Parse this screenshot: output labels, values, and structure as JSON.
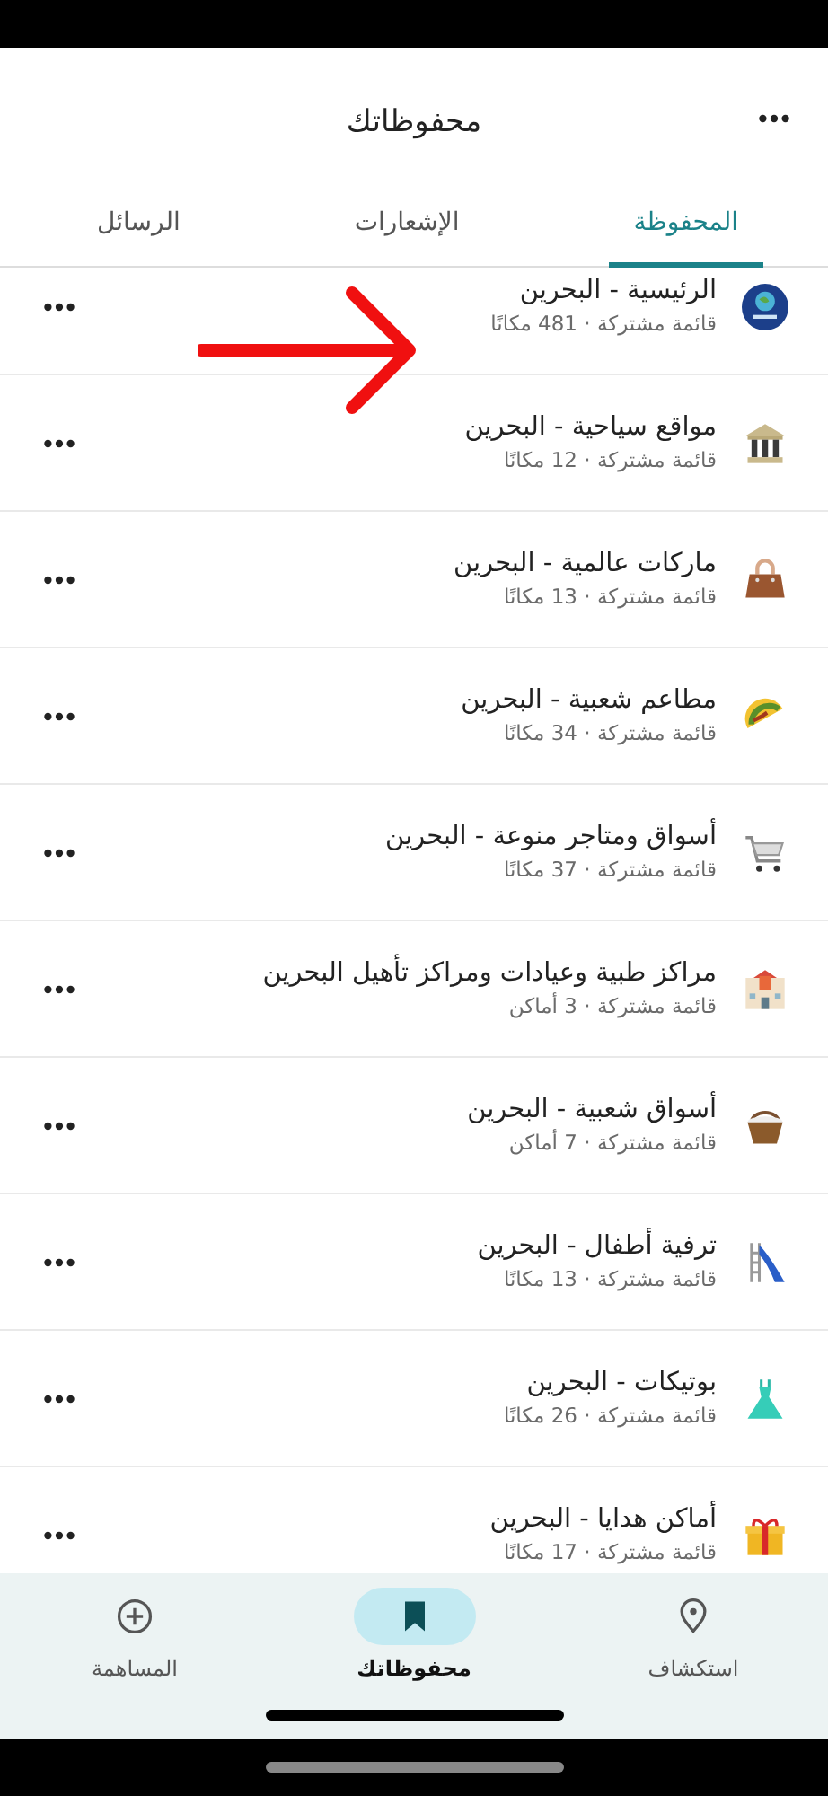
{
  "header": {
    "title": "محفوظاتك"
  },
  "tabs": [
    {
      "label": "المحفوظة",
      "selected": true
    },
    {
      "label": "الإشعارات",
      "selected": false
    },
    {
      "label": "الرسائل",
      "selected": false
    }
  ],
  "lists": [
    {
      "kind": "logo",
      "title": "الرئيسية - البحرين",
      "subtitle": "قائمة مشتركة · 481 مكانًا"
    },
    {
      "kind": "temple",
      "title": "مواقع سياحية - البحرين",
      "subtitle": "قائمة مشتركة · 12 مكانًا"
    },
    {
      "kind": "handbag",
      "title": "ماركات عالمية - البحرين",
      "subtitle": "قائمة مشتركة · 13 مكانًا"
    },
    {
      "kind": "taco",
      "title": "مطاعم شعبية - البحرين",
      "subtitle": "قائمة مشتركة · 34 مكانًا"
    },
    {
      "kind": "cart",
      "title": "أسواق ومتاجر منوعة - البحرين",
      "subtitle": "قائمة مشتركة · 37 مكانًا"
    },
    {
      "kind": "hospital",
      "title": "مراكز طبية وعيادات ومراكز تأهيل البحرين",
      "subtitle": "قائمة مشتركة · 3 أماكن"
    },
    {
      "kind": "basket",
      "title": "أسواق شعبية - البحرين",
      "subtitle": "قائمة مشتركة · 7 أماكن"
    },
    {
      "kind": "slide",
      "title": "ترفية أطفال - البحرين",
      "subtitle": "قائمة مشتركة · 13 مكانًا"
    },
    {
      "kind": "dress",
      "title": "بوتيكات - البحرين",
      "subtitle": "قائمة مشتركة · 26 مكانًا"
    },
    {
      "kind": "gift",
      "title": "أماكن هدايا - البحرين",
      "subtitle": "قائمة مشتركة · 17 مكانًا"
    }
  ],
  "nav": [
    {
      "kind": "explore",
      "label": "استكشاف",
      "selected": false
    },
    {
      "kind": "saved",
      "label": "محفوظاتك",
      "selected": true
    },
    {
      "kind": "contribute",
      "label": "المساهمة",
      "selected": false
    }
  ]
}
